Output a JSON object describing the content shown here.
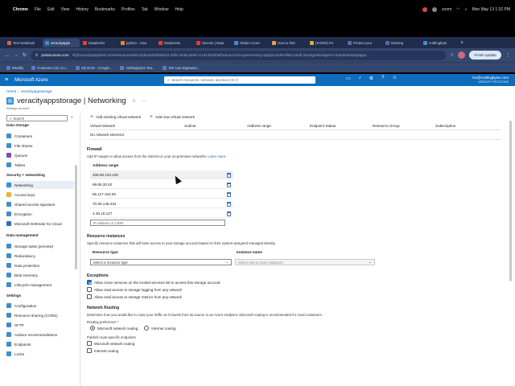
{
  "menubar": {
    "items": [
      "Chrome",
      "File",
      "Edit",
      "View",
      "History",
      "Bookmarks",
      "Profiles",
      "Tab",
      "Window",
      "Help"
    ],
    "zoom_label": "zoom",
    "clock": "Mon May 13  1:32 PM"
  },
  "tabs": [
    {
      "label": "Test Notebook",
      "color": "#e05d44"
    },
    {
      "label": "veracityapps",
      "color": "#3d8ed0",
      "active": true
    },
    {
      "label": "Databricks",
      "color": "#ff3621"
    },
    {
      "label": "python - How",
      "color": "#f48024"
    },
    {
      "label": "Databricks",
      "color": "#ff3621"
    },
    {
      "label": "Secrets | Data",
      "color": "#ff3621"
    },
    {
      "label": "Obtain Azure",
      "color": "#3d8ed0"
    },
    {
      "label": "How to find",
      "color": "#e8a33d"
    },
    {
      "label": "(XX000) Po",
      "color": "#e8a33d"
    },
    {
      "label": "Protect your",
      "color": "#6264a7"
    },
    {
      "label": "Meeting",
      "color": "#6264a7"
    },
    {
      "label": "craftingbyte",
      "color": "#3d8ed0"
    }
  ],
  "addressbar": {
    "host": "portal.azure.com",
    "path": "/#@veracityapptions.com/resource/subscriptions/8400eb24-23f2-4345-a2d9-cc7a14602bdf/resourceGroups/veracity-app/providers/Microsoft.Storage/storageAccounts/veracityapps...",
    "finish_update": "Finish update"
  },
  "bookmarks": [
    "Weebly",
    "Customer List, Co...",
    "My Drive - Google...",
    "craftingbytes Tea...",
    "SW Law Signature..."
  ],
  "azure": {
    "brand": "Microsoft Azure",
    "search_placeholder": "Search resources, services, and docs (G+/)",
    "user_email": "lee@craftingbytes.com",
    "user_org": "VERACITY PETITIONS"
  },
  "breadcrumb": {
    "home": "Home",
    "resource": "veracityappstorage"
  },
  "resource": {
    "name": "veracityappstorage",
    "section": "Networking",
    "type": "Storage account"
  },
  "sidebar": {
    "search_placeholder": "Search",
    "data_storage_group": "Data storage",
    "items_ds": [
      "Containers",
      "File shares",
      "Queues",
      "Tables"
    ],
    "security_group": "Security + networking",
    "items_sec": [
      "Networking",
      "Access keys",
      "Shared access signature",
      "Encryption",
      "Microsoft Defender for Cloud"
    ],
    "data_mgmt_group": "Data management",
    "items_dm": [
      "Storage tasks (preview)",
      "Redundancy",
      "Data protection",
      "Blob inventory",
      "Lifecycle management"
    ],
    "settings_group": "Settings",
    "items_set": [
      "Configuration",
      "Resource sharing (CORS)",
      "SFTP",
      "Advisor recommendations",
      "Endpoints",
      "Locks"
    ]
  },
  "vnet": {
    "add_existing": "Add existing virtual network",
    "add_new": "Add new virtual network",
    "columns": [
      "Virtual Network",
      "Subnet",
      "Address range",
      "Endpoint Status",
      "Resource Group",
      "Subscription"
    ],
    "empty": "No network selected."
  },
  "firewall": {
    "title": "Firewall",
    "desc": "Add IP ranges to allow access from the internet or your on-premises networks.",
    "learn_more": "Learn more.",
    "column": "Address range",
    "ips": [
      "108.60.103.226",
      "99.85.30.52",
      "65.117.152.90",
      "70.95.148.234",
      "4.36.15.147"
    ],
    "input_placeholder": "IP address or CIDR"
  },
  "resource_instances": {
    "title": "Resource instances",
    "desc": "Specify resource instances that will have access to your storage account based on their system-assigned managed identity.",
    "col_type": "Resource type",
    "col_name": "Instance name",
    "type_placeholder": "Select a resource type",
    "name_placeholder": "Select one or more instances"
  },
  "exceptions": {
    "title": "Exceptions",
    "items": [
      {
        "label": "Allow Azure services on the trusted services list to access this storage account.",
        "checked": true
      },
      {
        "label": "Allow read access to storage logging from any network",
        "checked": false
      },
      {
        "label": "Allow read access to storage metrics from any network",
        "checked": false
      }
    ]
  },
  "routing": {
    "title": "Network Routing",
    "desc": "Determine how you would like to route your traffic as it travels from its source to an Azure endpoint. Microsoft routing is recommended for most customers.",
    "pref_label": "Routing preference *",
    "options": [
      "Microsoft network routing",
      "Internet routing"
    ],
    "publish_label": "Publish route-specific endpoints",
    "publish_items": [
      "Microsoft network routing",
      "Internet routing"
    ]
  }
}
